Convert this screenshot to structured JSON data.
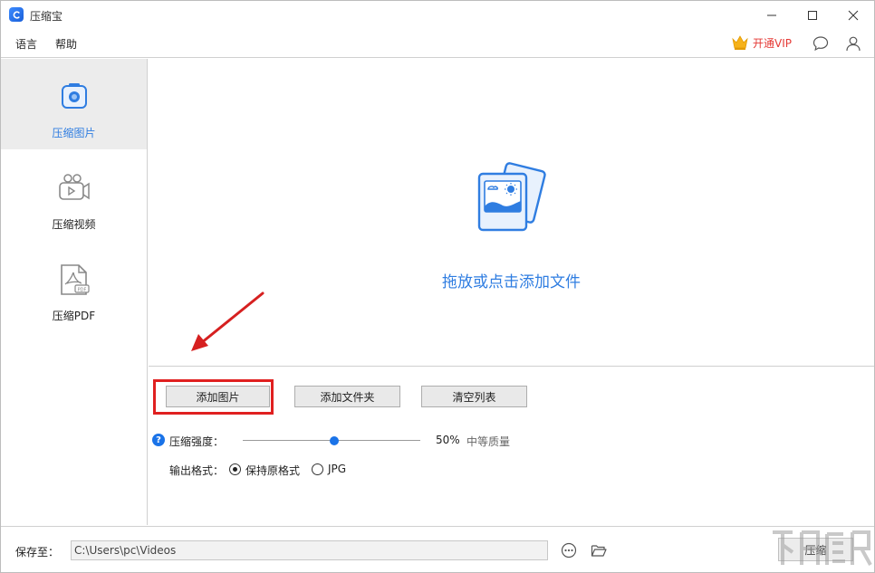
{
  "window": {
    "title": "压缩宝"
  },
  "menu": {
    "language": "语言",
    "help": "帮助"
  },
  "header": {
    "vip_label": "开通VIP"
  },
  "sidebar": {
    "items": [
      {
        "label": "压缩图片",
        "icon": "camera-icon",
        "active": true
      },
      {
        "label": "压缩视频",
        "icon": "video-camera-icon",
        "active": false
      },
      {
        "label": "压缩PDF",
        "icon": "pdf-icon",
        "active": false
      }
    ]
  },
  "dropzone": {
    "text": "拖放或点击添加文件"
  },
  "actions": {
    "add_image": "添加图片",
    "add_folder": "添加文件夹",
    "clear_list": "清空列表"
  },
  "settings": {
    "strength_label": "压缩强度：",
    "strength_value": 50,
    "strength_percent": "50%",
    "quality_label": "中等质量",
    "format_label": "输出格式：",
    "format_options": [
      "保持原格式",
      "JPG"
    ],
    "format_selected": "保持原格式"
  },
  "bottom": {
    "save_label": "保存至：",
    "save_path": "C:\\Users\\pc\\Videos",
    "compress_button": "压缩"
  },
  "colors": {
    "accent": "#2f7de1",
    "vip": "#e53935",
    "highlight": "#e02020"
  }
}
